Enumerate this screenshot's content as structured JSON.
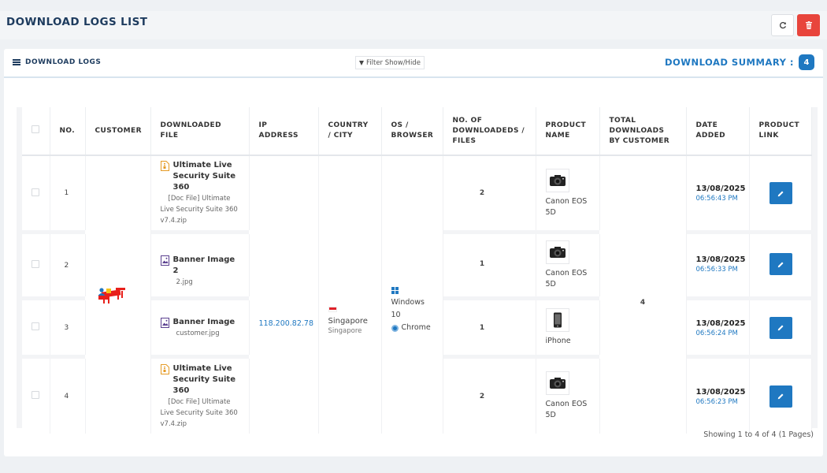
{
  "page": {
    "title": "DOWNLOAD LOGS LIST"
  },
  "panel": {
    "title": "DOWNLOAD LOGS",
    "filter_label": "Filter Show/Hide",
    "summary_label": "DOWNLOAD SUMMARY :",
    "summary_count": "4"
  },
  "table": {
    "columns": {
      "no": "NO.",
      "customer": "CUSTOMER",
      "file": "DOWNLOADED FILE",
      "ip": "IP ADDRESS",
      "country": "COUNTRY / CITY",
      "os": "OS / BROWSER",
      "count": "NO. OF DOWNLOADEDS / FILES",
      "product": "PRODUCT NAME",
      "total": "TOTAL DOWNLOADS BY CUSTOMER",
      "date": "DATE ADDED",
      "link": "PRODUCT LINK"
    },
    "shared": {
      "ip": "118.200.82.78",
      "country": "Singapore",
      "city": "Singapore",
      "os": "Windows 10",
      "browser": "Chrome",
      "total": "4"
    },
    "rows": [
      {
        "no": "1",
        "file_name": "Ultimate Live Security Suite 360",
        "file_sub": "[Doc File] Ultimate Live Security Suite 360 v7.4.zip",
        "file_icon": "zip-file-icon",
        "count": "2",
        "product_icon": "camera-icon",
        "product": "Canon EOS 5D",
        "date": "13/08/2025",
        "time": "06:56:43 PM"
      },
      {
        "no": "2",
        "file_name": "Banner Image 2",
        "file_sub": "2.jpg",
        "file_icon": "image-file-icon",
        "count": "1",
        "product_icon": "camera-icon",
        "product": "Canon EOS 5D",
        "date": "13/08/2025",
        "time": "06:56:33 PM"
      },
      {
        "no": "3",
        "file_name": "Banner Image",
        "file_sub": "customer.jpg",
        "file_icon": "image-file-icon",
        "count": "1",
        "product_icon": "phone-icon",
        "product": "iPhone",
        "date": "13/08/2025",
        "time": "06:56:24 PM"
      },
      {
        "no": "4",
        "file_name": "Ultimate Live Security Suite 360",
        "file_sub": "[Doc File] Ultimate Live Security Suite 360 v7.4.zip",
        "file_icon": "zip-file-icon",
        "count": "2",
        "product_icon": "camera-icon",
        "product": "Canon EOS 5D",
        "date": "13/08/2025",
        "time": "06:56:23 PM"
      }
    ]
  },
  "pagination": {
    "info": "Showing 1 to 4 of 4 (1 Pages)"
  },
  "colors": {
    "accent": "#1f78c1",
    "navy": "#1d3b5e",
    "danger": "#e8453c",
    "total": "#e8201b"
  }
}
